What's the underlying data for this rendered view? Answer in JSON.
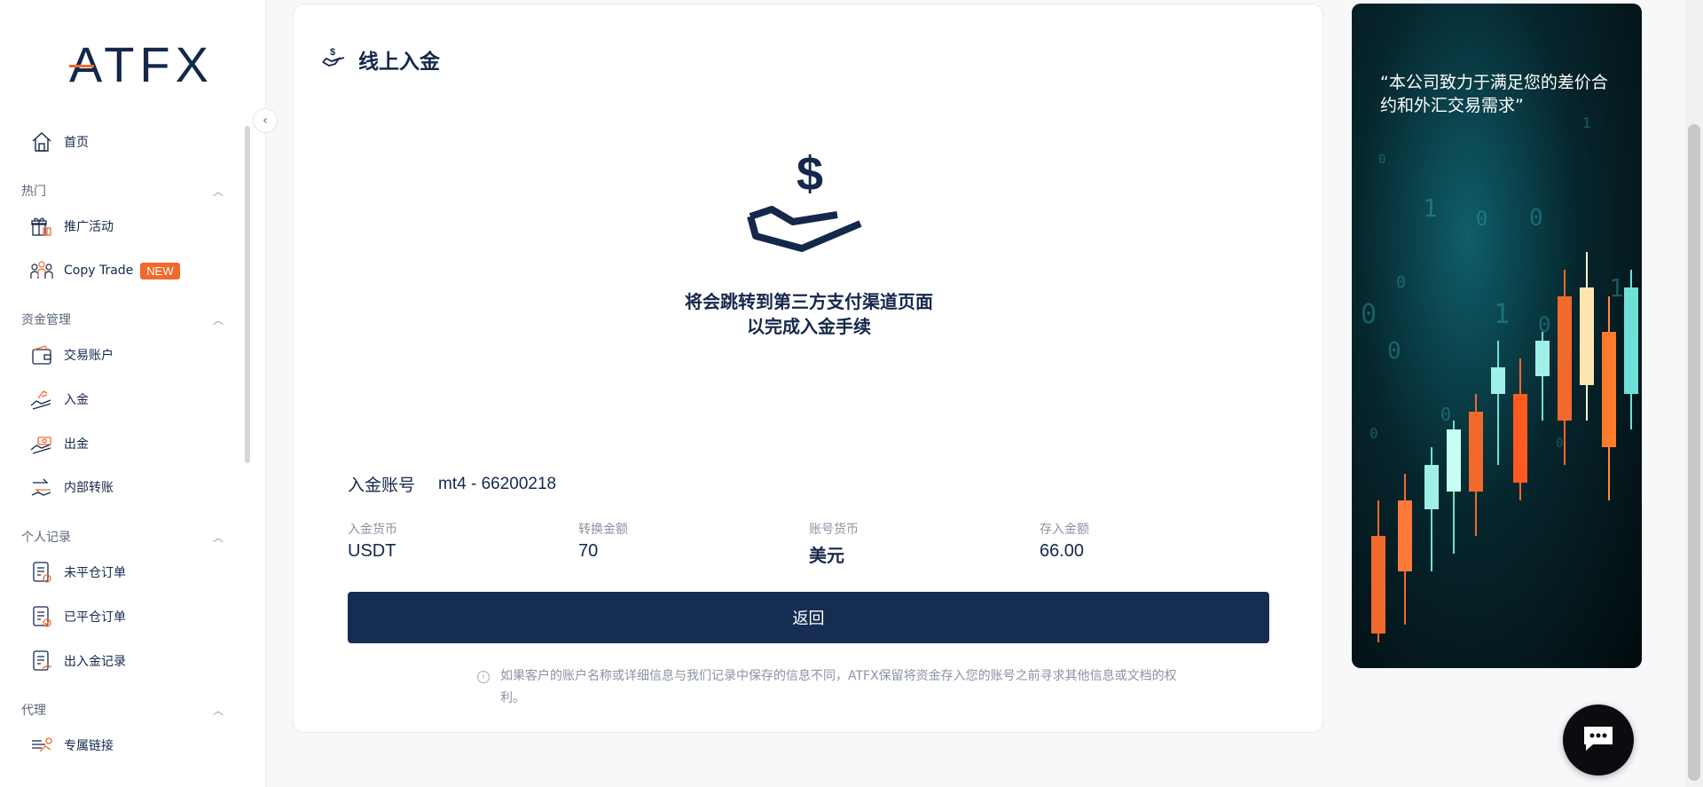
{
  "brand": {
    "logo": "ATFX",
    "accent": "#f26a2b",
    "navy": "#15284b"
  },
  "sidebar": {
    "home": {
      "label": "首页",
      "icon": "home-icon"
    },
    "sections": [
      {
        "title": "热门",
        "items": [
          {
            "label": "推广活动",
            "icon": "gift-icon"
          },
          {
            "label": "Copy Trade",
            "icon": "people-icon",
            "badge": "NEW"
          }
        ]
      },
      {
        "title": "资金管理",
        "items": [
          {
            "label": "交易账户",
            "icon": "wallet-icon"
          },
          {
            "label": "入金",
            "icon": "deposit-icon"
          },
          {
            "label": "出金",
            "icon": "withdraw-icon"
          },
          {
            "label": "内部转账",
            "icon": "transfer-icon"
          }
        ]
      },
      {
        "title": "个人记录",
        "items": [
          {
            "label": "未平仓订单",
            "icon": "open-orders-icon"
          },
          {
            "label": "已平仓订单",
            "icon": "closed-orders-icon"
          },
          {
            "label": "出入金记录",
            "icon": "funding-records-icon"
          }
        ]
      },
      {
        "title": "代理",
        "items": [
          {
            "label": "专属链接",
            "icon": "link-icon"
          }
        ]
      }
    ]
  },
  "main": {
    "title": "线上入金",
    "message_line1": "将会跳转到第三方支付渠道页面",
    "message_line2": "以完成入金手续",
    "account_label": "入金账号",
    "account_value": "mt4 - 66200218",
    "fields": [
      {
        "label": "入金货币",
        "value": "USDT"
      },
      {
        "label": "转换金额",
        "value": "70"
      },
      {
        "label": "账号货币",
        "value": "美元"
      },
      {
        "label": "存入金额",
        "value": "66.00"
      }
    ],
    "back_button": "返回",
    "notice": "如果客户的账户名称或详细信息与我们记录中保存的信息不同，ATFX保留将资金存入您的账号之前寻求其他信息或文档的权利。"
  },
  "promo": {
    "text": "“本公司致力于满足您的差价合约和外汇交易需求”"
  },
  "chat": {
    "icon": "chat-icon"
  }
}
